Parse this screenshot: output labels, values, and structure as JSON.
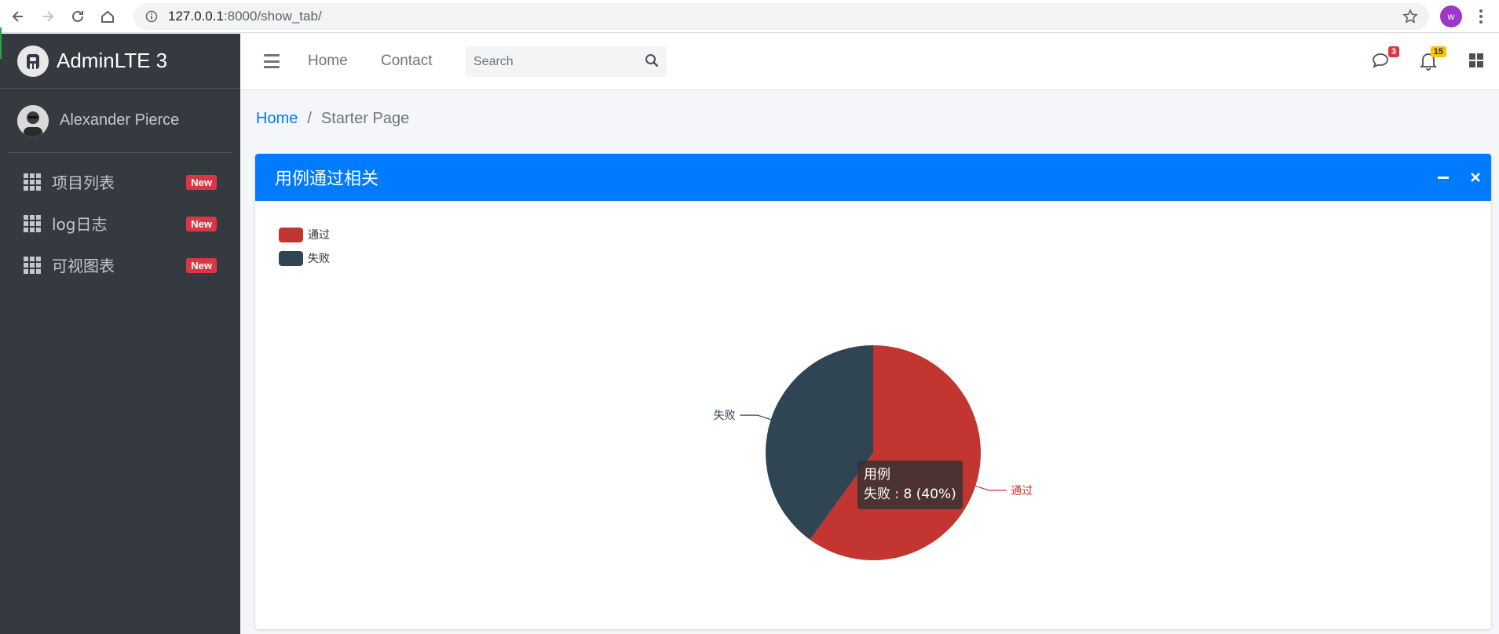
{
  "browser": {
    "url_host": "127.0.0.1",
    "url_path": ":8000/show_tab/",
    "profile_initial": "w"
  },
  "sidebar": {
    "brand": "AdminLTE 3",
    "user_name": "Alexander Pierce",
    "items": [
      {
        "label": "项目列表",
        "badge": "New",
        "icon": "th-icon"
      },
      {
        "label": "log日志",
        "badge": "New",
        "icon": "th-icon"
      },
      {
        "label": "可视图表",
        "badge": "New",
        "icon": "th-icon"
      }
    ]
  },
  "navbar": {
    "links": [
      "Home",
      "Contact"
    ],
    "search_placeholder": "Search",
    "messages_count": "3",
    "notifications_count": "15",
    "colors": {
      "danger": "#dc3545",
      "warning": "#ffc107"
    }
  },
  "breadcrumb": {
    "home": "Home",
    "separator": "/",
    "active": "Starter Page"
  },
  "card": {
    "title": "用例通过相关",
    "header_color": "#007bff"
  },
  "chart_data": {
    "type": "pie",
    "series_name": "用例",
    "categories": [
      "通过",
      "失败"
    ],
    "values": [
      12,
      8
    ],
    "colors": [
      "#c23531",
      "#2f4554"
    ],
    "legend_position": "top-left",
    "tooltip": {
      "title": "用例",
      "text": "失败 : 8 (40%)"
    }
  }
}
